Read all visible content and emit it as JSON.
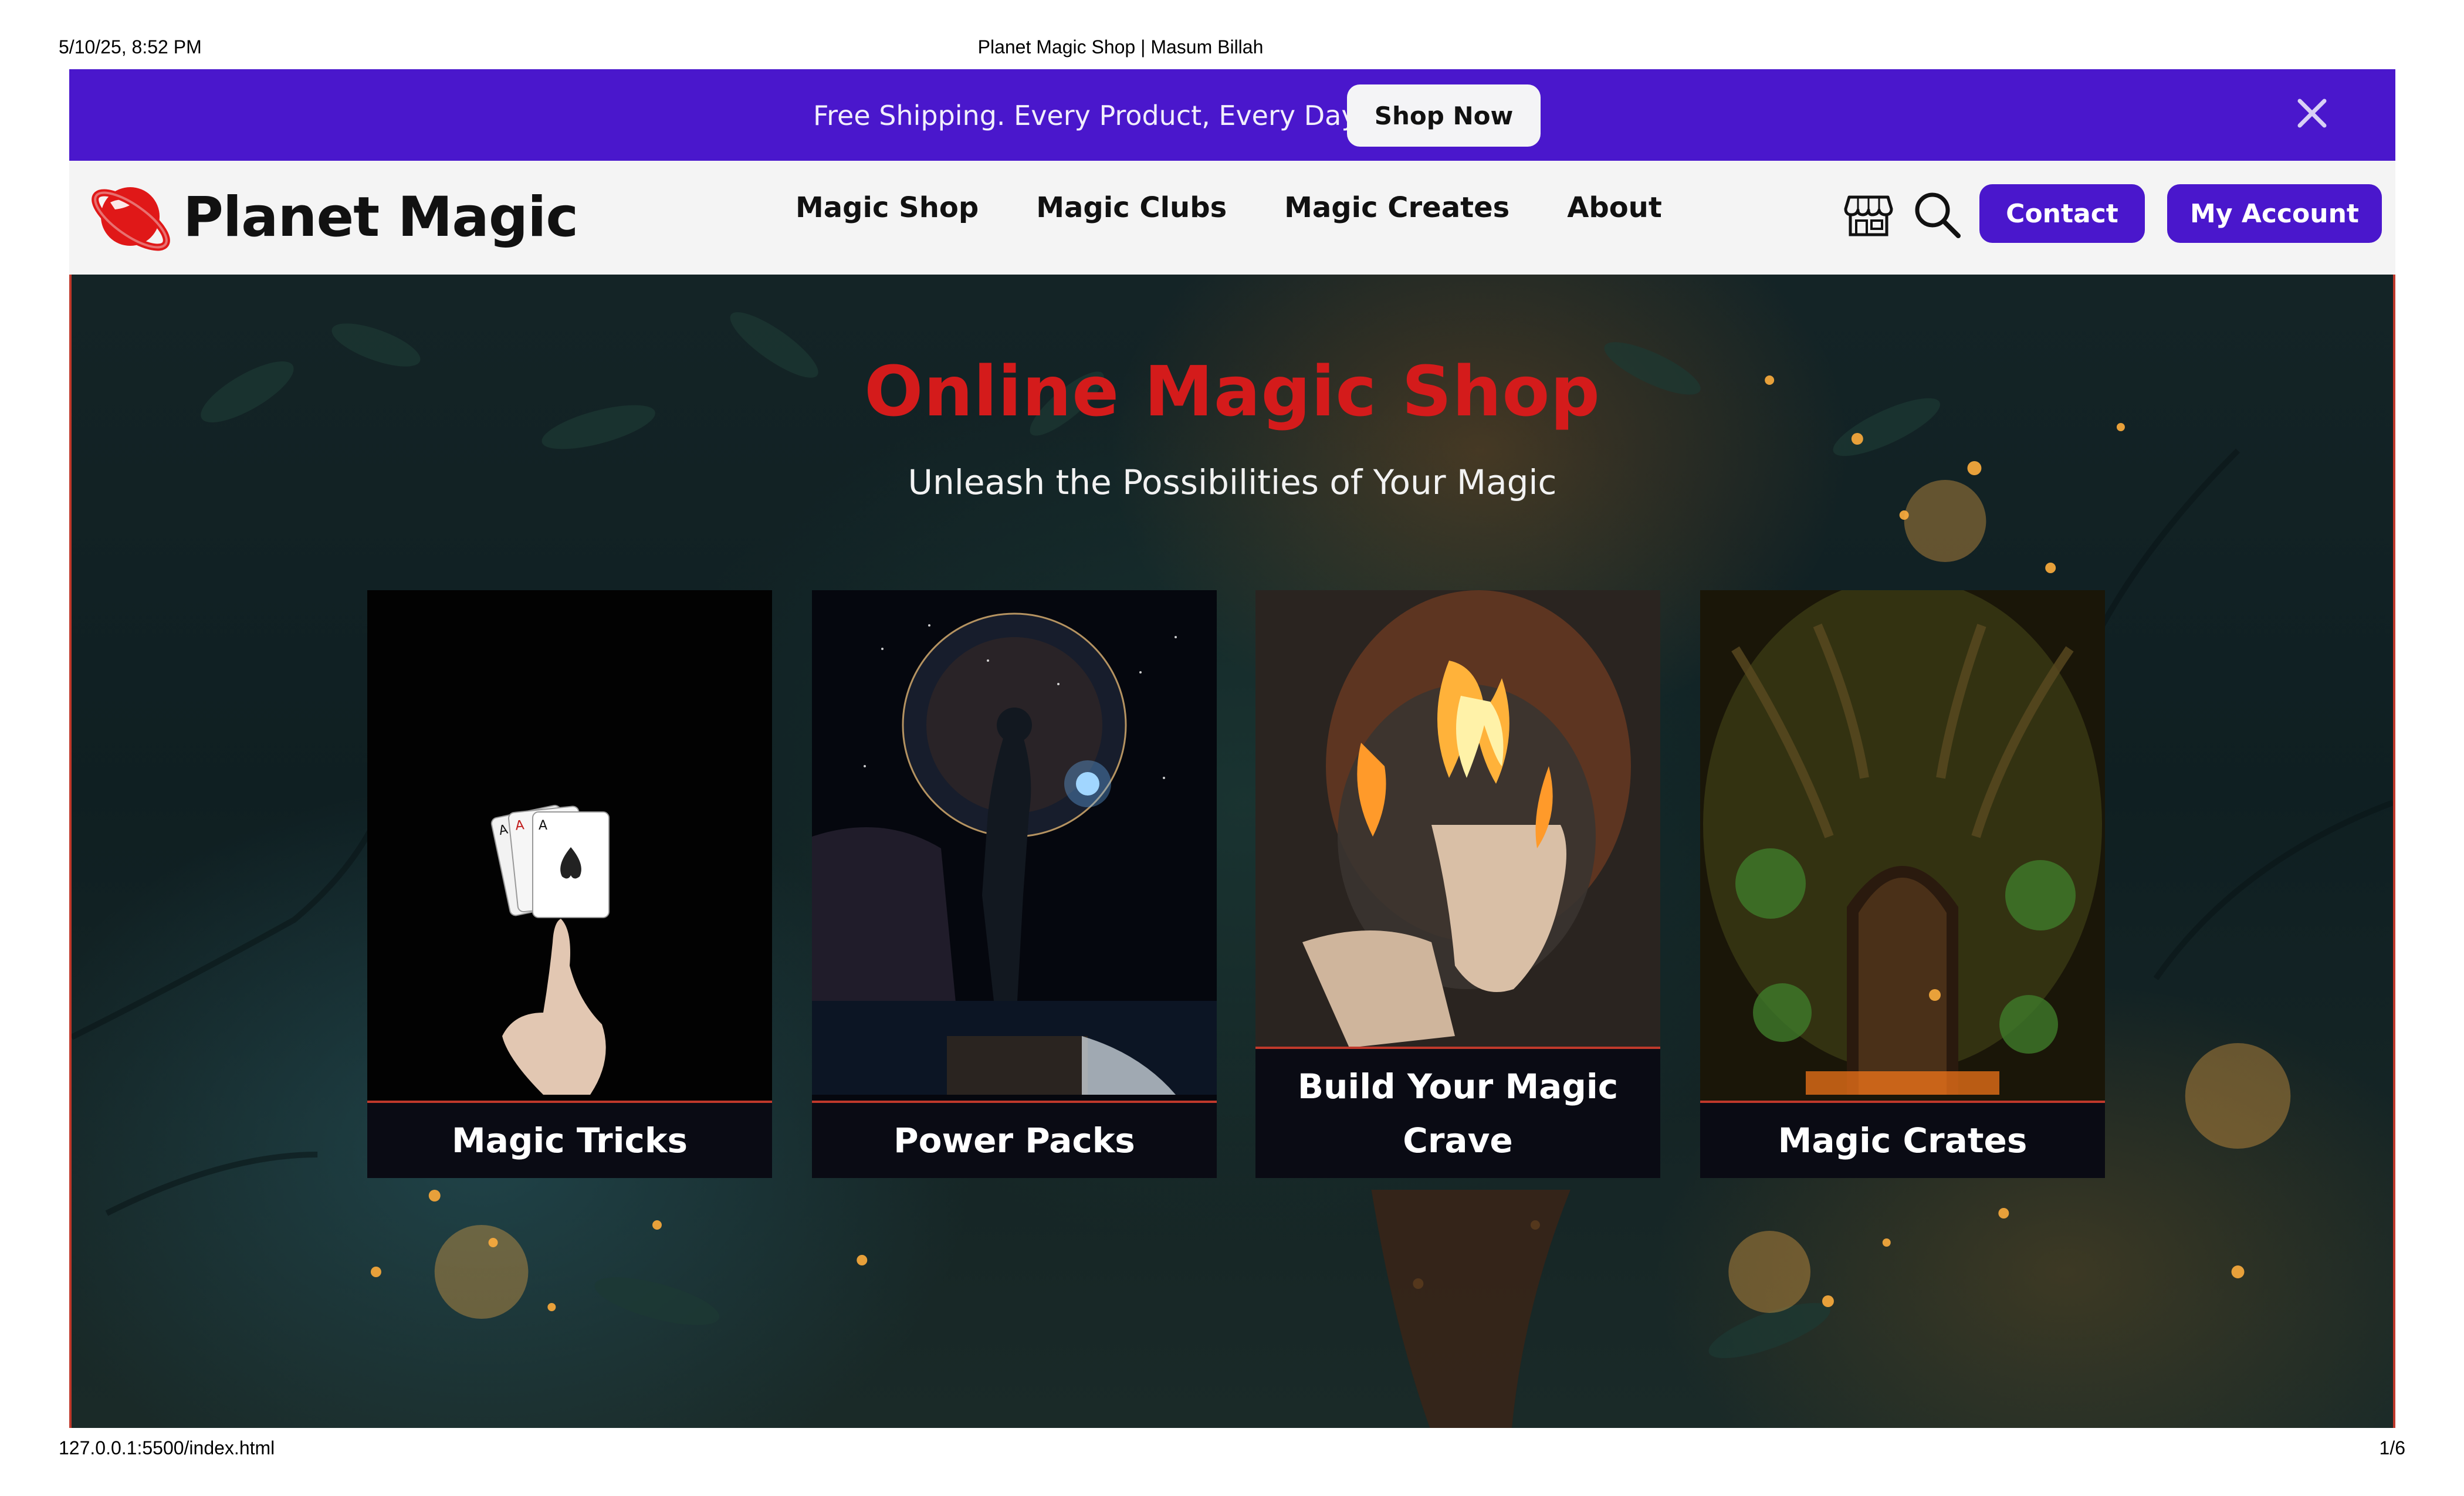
{
  "print_header": {
    "datetime": "5/10/25, 8:52 PM",
    "title": "Planet Magic Shop | Masum Billah"
  },
  "print_footer": {
    "url": "127.0.0.1:5500/index.html",
    "page": "1/6"
  },
  "promo_bar": {
    "text": "Free Shipping. Every Product, Every Day.",
    "button_label": "Shop Now",
    "close_icon": "close-icon",
    "background_color": "#4a17cc"
  },
  "nav": {
    "logo_text": "Planet Magic",
    "logo_icon": "planet-icon",
    "links": [
      "Magic Shop",
      "Magic Clubs",
      "Magic Creates",
      "About"
    ],
    "icons": [
      "store-icon",
      "search-icon"
    ],
    "contact_label": "Contact",
    "account_label": "My Account",
    "button_color": "#4a17cc"
  },
  "hero": {
    "title": "Online Magic Shop",
    "subtitle": "Unleash the Possibilities of Your Magic",
    "title_color": "#d41b1b"
  },
  "cards": [
    {
      "label": "Magic Tricks",
      "image": "playing-cards-balanced-on-finger"
    },
    {
      "label": "Power Packs",
      "image": "cosmic-figure-on-rock"
    },
    {
      "label": "Build Your Magic Crave",
      "image": "flaming-hand"
    },
    {
      "label": "Magic Crates",
      "image": "enchanted-tree-door"
    }
  ]
}
